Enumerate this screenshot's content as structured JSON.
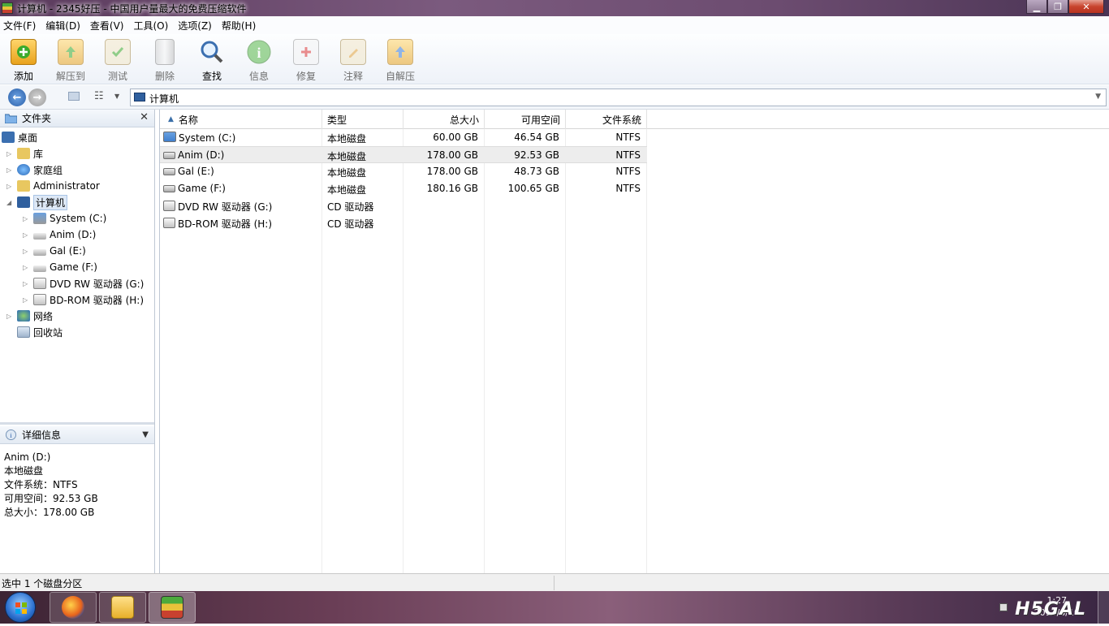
{
  "window": {
    "title": "计算机 - 2345好压 - 中国用户量最大的免费压缩软件"
  },
  "menu": [
    "文件(F)",
    "编辑(D)",
    "查看(V)",
    "工具(O)",
    "选项(Z)",
    "帮助(H)"
  ],
  "toolbar": {
    "buttons": [
      {
        "label": "添加",
        "icon": "add-archive-icon",
        "enabled": true
      },
      {
        "label": "解压到",
        "icon": "extract-to-icon",
        "enabled": false
      },
      {
        "label": "测试",
        "icon": "test-icon",
        "enabled": false
      },
      {
        "label": "删除",
        "icon": "delete-icon",
        "enabled": false
      },
      {
        "label": "查找",
        "icon": "find-icon",
        "enabled": true
      },
      {
        "label": "信息",
        "icon": "info-icon",
        "enabled": false
      },
      {
        "label": "修复",
        "icon": "repair-icon",
        "enabled": false
      },
      {
        "label": "注释",
        "icon": "comment-icon",
        "enabled": false
      },
      {
        "label": "自解压",
        "icon": "sfx-icon",
        "enabled": false
      }
    ]
  },
  "address": {
    "path": "计算机"
  },
  "folders_pane": {
    "title": "文件夹",
    "tree": [
      {
        "label": "桌面",
        "icon": "desktop-icon"
      },
      {
        "label": "库",
        "icon": "library-icon"
      },
      {
        "label": "家庭组",
        "icon": "homegroup-icon"
      },
      {
        "label": "Administrator",
        "icon": "user-folder-icon"
      },
      {
        "label": "计算机",
        "icon": "computer-icon",
        "selected": true
      },
      {
        "label": "System (C:)",
        "icon": "system-drive-icon"
      },
      {
        "label": "Anim (D:)",
        "icon": "hard-drive-icon"
      },
      {
        "label": "Gal (E:)",
        "icon": "hard-drive-icon"
      },
      {
        "label": "Game (F:)",
        "icon": "hard-drive-icon"
      },
      {
        "label": "DVD RW 驱动器 (G:)",
        "icon": "optical-drive-icon"
      },
      {
        "label": "BD-ROM 驱动器 (H:)",
        "icon": "optical-drive-icon"
      },
      {
        "label": "网络",
        "icon": "network-icon"
      },
      {
        "label": "回收站",
        "icon": "recycle-bin-icon"
      }
    ]
  },
  "details_pane": {
    "title": "详细信息",
    "lines": [
      "Anim (D:)",
      "本地磁盘",
      "文件系统：NTFS",
      "可用空间：92.53 GB",
      "总大小：178.00 GB"
    ]
  },
  "list": {
    "columns": [
      "名称",
      "类型",
      "总大小",
      "可用空间",
      "文件系统"
    ],
    "rows": [
      {
        "name": "System (C:)",
        "type": "本地磁盘",
        "total": "60.00 GB",
        "free": "46.54 GB",
        "fs": "NTFS",
        "icon": "system-drive-icon"
      },
      {
        "name": "Anim (D:)",
        "type": "本地磁盘",
        "total": "178.00 GB",
        "free": "92.53 GB",
        "fs": "NTFS",
        "icon": "hard-drive-icon",
        "selected": true
      },
      {
        "name": "Gal (E:)",
        "type": "本地磁盘",
        "total": "178.00 GB",
        "free": "48.73 GB",
        "fs": "NTFS",
        "icon": "hard-drive-icon"
      },
      {
        "name": "Game (F:)",
        "type": "本地磁盘",
        "total": "180.16 GB",
        "free": "100.65 GB",
        "fs": "NTFS",
        "icon": "hard-drive-icon"
      },
      {
        "name": "DVD RW 驱动器 (G:)",
        "type": "CD 驱动器",
        "total": "",
        "free": "",
        "fs": "",
        "icon": "optical-drive-icon"
      },
      {
        "name": "BD-ROM 驱动器 (H:)",
        "type": "CD 驱动器",
        "total": "",
        "free": "",
        "fs": "",
        "icon": "optical-drive-icon"
      }
    ]
  },
  "status": {
    "text": "选中 1 个磁盘分区"
  },
  "taskbar": {
    "apps": [
      {
        "name": "firefox-icon"
      },
      {
        "name": "explorer-icon"
      },
      {
        "name": "haozip-icon"
      }
    ],
    "clock_time": "1:27",
    "clock_date": "2013/6/10"
  },
  "watermark": "H5GAL"
}
